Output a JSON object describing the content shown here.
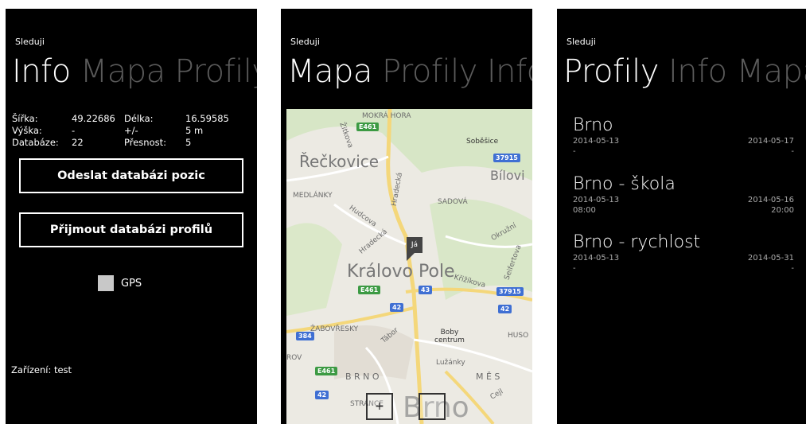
{
  "app_title": "Sleduji",
  "info_screen": {
    "pivot": [
      "Info",
      "Mapa",
      "Profily"
    ],
    "stats": [
      {
        "label": "Šířka:",
        "value": "49.22686",
        "label2": "Délka:",
        "value2": "16.59585"
      },
      {
        "label": "Výška:",
        "value": "-",
        "label2": "+/-",
        "value2": "5 m"
      },
      {
        "label": "Databáze:",
        "value": "22",
        "label2": "Přesnost:",
        "value2": "5"
      }
    ],
    "send_button": "Odeslat databázi pozic",
    "receive_button": "Přijmout databázi profilů",
    "gps_label": "GPS",
    "device_label": "Zařízení: test"
  },
  "map_screen": {
    "pivot": [
      "Mapa",
      "Profily",
      "Info"
    ],
    "labels": {
      "mokra_hora": "MOKRÁ HORA",
      "zidkova": "Žitkova",
      "sobesice": "Soběšice",
      "reckovice": "Řečkovice",
      "bilovi": "Bílovi",
      "medlanky": "MEDLÁNKY",
      "hradecka": "Hradecká",
      "sadova": "SADOVÁ",
      "hudcova": "Hudcova",
      "hradecka2": "Hradecká",
      "okruzni": "Okružní",
      "kralovo_pole": "Královo Pole",
      "krizikova": "Křižíkova",
      "seifertova": "Seifertova",
      "zabovresky": "ŽABOVŘESKY",
      "tabor": "Tábor",
      "boby": "Boby\ncentrum",
      "huso": "HUSO",
      "rov": "ROV",
      "luzanky": "Lužánky",
      "brno_letters": "B  R  N  O",
      "m_e_s": "M  Ě  S",
      "strance": "STRÁNCE",
      "cejl": "Cejl",
      "brno_big": "Brno"
    },
    "shields": {
      "e461_top": "E461",
      "s37915_top": "37915",
      "e461_mid": "E461",
      "s43": "43",
      "s37915_mid": "37915",
      "s42_mid": "42",
      "s42_right": "42",
      "s384": "384",
      "e461_bottom": "E461",
      "s42_bottom": "42"
    },
    "pin_label": "Já",
    "zoom_in_symbol": "+",
    "zoom_out_symbol": ""
  },
  "profiles_screen": {
    "pivot": [
      "Profily",
      "Info",
      "Mapa"
    ],
    "profiles": [
      {
        "name": "Brno",
        "start": "2014-05-13",
        "end": "2014-05-17",
        "start_time": "-",
        "end_time": "-"
      },
      {
        "name": "Brno - škola",
        "start": "2014-05-13",
        "end": "2014-05-16",
        "start_time": "08:00",
        "end_time": "20:00"
      },
      {
        "name": "Brno - rychlost",
        "start": "2014-05-13",
        "end": "2014-05-31",
        "start_time": "-",
        "end_time": "-"
      }
    ]
  },
  "colors": {
    "background": "#000000",
    "foreground": "#ffffff",
    "inactive_pivot": "#5b5b5b",
    "road_green": "#3c9a43",
    "road_blue": "#3f6fd3"
  }
}
